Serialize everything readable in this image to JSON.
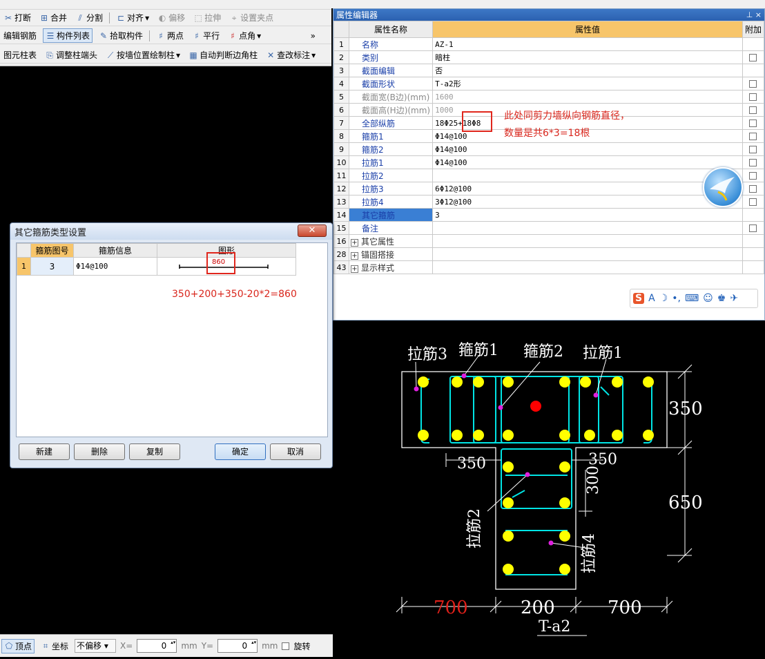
{
  "toolbar": {
    "row0": [
      {
        "label": "",
        "icon": "partial-icon"
      }
    ],
    "row1": [
      {
        "label": "打断",
        "icon": "break-icon"
      },
      {
        "label": "合并",
        "icon": "merge-icon"
      },
      {
        "label": "分割",
        "icon": "split-icon"
      },
      {
        "label": "对齐",
        "icon": "align-icon",
        "dropdown": true
      },
      {
        "label": "偏移",
        "icon": "offset-icon",
        "disabled": true
      },
      {
        "label": "拉伸",
        "icon": "stretch-icon",
        "disabled": true
      },
      {
        "label": "设置夹点",
        "icon": "grip-icon",
        "disabled": true
      }
    ],
    "row2": [
      {
        "label": "编辑钢筋",
        "icon": "edit-rebar-icon"
      },
      {
        "label": "构件列表",
        "icon": "list-icon",
        "pressed": true
      },
      {
        "label": "拾取构件",
        "icon": "pick-icon"
      },
      {
        "label": "两点",
        "icon": "two-points-icon"
      },
      {
        "label": "平行",
        "icon": "parallel-icon"
      },
      {
        "label": "点角",
        "icon": "point-angle-icon",
        "dropdown": true
      }
    ],
    "row3": [
      {
        "label": "图元柱表",
        "icon": "column-table-icon"
      },
      {
        "label": "调整柱端头",
        "icon": "adjust-end-icon"
      },
      {
        "label": "按墙位置绘制柱",
        "icon": "draw-by-wall-icon",
        "dropdown": true
      },
      {
        "label": "自动判断边角柱",
        "icon": "auto-corner-icon"
      },
      {
        "label": "查改标注",
        "icon": "check-label-icon",
        "dropdown": true
      }
    ]
  },
  "property_editor": {
    "title": "属性编辑器",
    "pin_icon": "pin-icon",
    "close_icon": "close-icon",
    "headers": {
      "name": "属性名称",
      "value": "属性值",
      "extra": "附加"
    },
    "rows": [
      {
        "no": "1",
        "name": "名称",
        "value": "AZ-1",
        "checkbox": false
      },
      {
        "no": "2",
        "name": "类别",
        "value": "暗柱",
        "checkbox": true
      },
      {
        "no": "3",
        "name": "截面编辑",
        "value": "否",
        "checkbox": false
      },
      {
        "no": "4",
        "name": "截面形状",
        "value": "T-a2形",
        "checkbox": true
      },
      {
        "no": "5",
        "name": "截面宽(B边)(mm)",
        "value": "1600",
        "checkbox": true,
        "gray": true
      },
      {
        "no": "6",
        "name": "截面高(H边)(mm)",
        "value": "1000",
        "checkbox": true,
        "gray": true
      },
      {
        "no": "7",
        "name": "全部纵筋",
        "value": "18Φ25+18Φ8",
        "checkbox": true
      },
      {
        "no": "8",
        "name": "箍筋1",
        "value": "Φ14@100",
        "checkbox": true
      },
      {
        "no": "9",
        "name": "箍筋2",
        "value": "Φ14@100",
        "checkbox": true
      },
      {
        "no": "10",
        "name": "拉筋1",
        "value": "Φ14@100",
        "checkbox": true
      },
      {
        "no": "11",
        "name": "拉筋2",
        "value": "",
        "checkbox": true
      },
      {
        "no": "12",
        "name": "拉筋3",
        "value": "6Φ12@100",
        "checkbox": true
      },
      {
        "no": "13",
        "name": "拉筋4",
        "value": "3Φ12@100",
        "checkbox": true
      },
      {
        "no": "14",
        "name": "其它箍筋",
        "value": "3",
        "checkbox": false,
        "selected": true
      },
      {
        "no": "15",
        "name": "备注",
        "value": "",
        "checkbox": true
      },
      {
        "no": "16",
        "name": "其它属性",
        "value": "",
        "group": true
      },
      {
        "no": "28",
        "name": "锚固搭接",
        "value": "",
        "group": true
      },
      {
        "no": "43",
        "name": "显示样式",
        "value": "",
        "group": true
      }
    ],
    "annotation_line1": "此处同剪力墙纵向钢筋直径，",
    "annotation_line2": "数量是共6*3=18根"
  },
  "ime_bar": {
    "icons": [
      "sogou-icon",
      "chinese-mode-icon",
      "moon-icon",
      "punct-icon",
      "keyboard-icon",
      "voice-icon",
      "shirt-icon",
      "wrench-icon"
    ],
    "mode_label": "A"
  },
  "dialog": {
    "title": "其它箍筋类型设置",
    "close_label": "✕",
    "headers": {
      "shape_no": "箍筋图号",
      "info": "箍筋信息",
      "figure": "图形"
    },
    "rows": [
      {
        "no": "1",
        "shape_no": "3",
        "info": "Φ14@100",
        "figure_value": "860"
      }
    ],
    "formula": "350+200+350-20*2=860",
    "buttons": {
      "new": "新建",
      "delete": "删除",
      "copy": "复制",
      "ok": "确定",
      "cancel": "取消"
    }
  },
  "status_bar": {
    "vertex": "顶点",
    "coord": "坐标",
    "offset_mode": "不偏移",
    "x_label": "X=",
    "x_value": "0",
    "y_label": "Y=",
    "y_value": "0",
    "unit": "mm",
    "rotate": "旋转"
  },
  "drawing": {
    "labels": {
      "tie3": "拉筋3",
      "stirrup1": "箍筋1",
      "stirrup2": "箍筋2",
      "tie1": "拉筋1",
      "tie2": "拉筋2",
      "tie4": "拉筋4"
    },
    "dims": {
      "d350_right": "350",
      "d650": "650",
      "d350_left": "350",
      "d350_mid": "350",
      "d300": "300",
      "d700_left": "700",
      "d200": "200",
      "d700_right": "700"
    },
    "shape_name": "T-a2",
    "colors": {
      "outline": "#ffffff",
      "rebar": "#ffff00",
      "stirrup": "#00e5e5",
      "center": "#ff0000",
      "marker": "#e020e0",
      "red_dim": "#e0201a"
    }
  }
}
